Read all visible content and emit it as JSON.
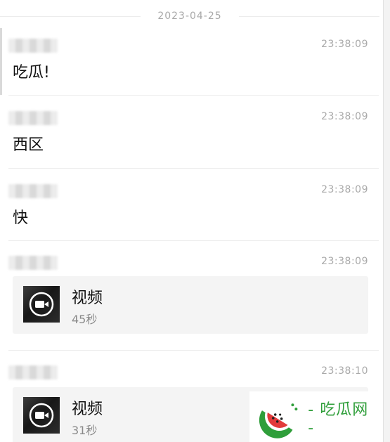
{
  "date_separator": "2023-04-25",
  "messages": [
    {
      "time": "23:38:09",
      "text": "吃瓜!"
    },
    {
      "time": "23:38:09",
      "text": "西区"
    },
    {
      "time": "23:38:09",
      "text": "快"
    },
    {
      "time": "23:38:09",
      "video_label": "视频",
      "video_duration": "45秒"
    },
    {
      "time": "23:38:10",
      "video_label": "视频",
      "video_duration": "31秒"
    }
  ],
  "icons": {
    "video_play": "video-camera-icon",
    "watermark_logo": "watermelon-logo-icon"
  },
  "watermark": {
    "text": "- 吃瓜网 -"
  },
  "colors": {
    "time_text": "#a9a9a9",
    "card_background": "#f4f4f4",
    "watermark_green": "#2f9e3a",
    "watermark_red": "#e23b3b"
  }
}
